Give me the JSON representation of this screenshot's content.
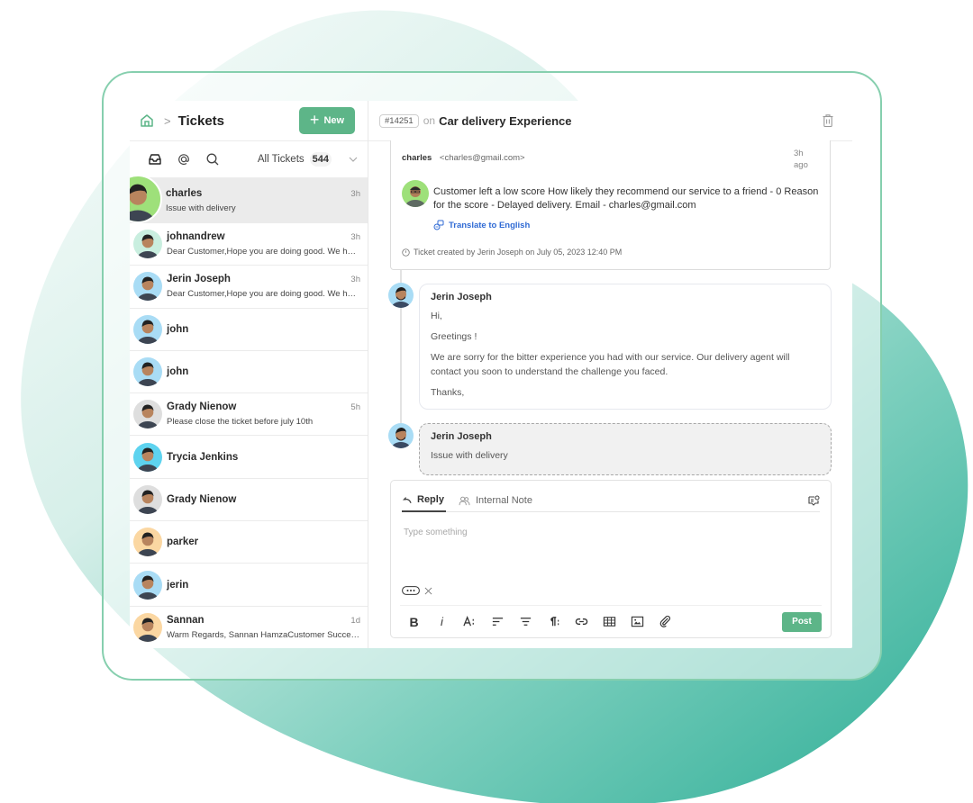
{
  "colors": {
    "brand": "#5db588",
    "link": "#2f6ad4",
    "frame_border": "#86cfae",
    "blob_dark": "#3eb39d",
    "blob_light": "#e8f5f2"
  },
  "sidebar": {
    "home_icon": "home-icon",
    "breadcrumb_separator": ">",
    "title": "Tickets",
    "new_button_icon": "plus-icon",
    "new_button_label": "New",
    "filter_icons": [
      "inbox-icon",
      "at-mention-icon",
      "search-icon"
    ],
    "filter_label": "All Tickets",
    "filter_count": "544",
    "tickets": [
      {
        "name": "charles",
        "time": "3h",
        "preview": "Issue with delivery",
        "active": true,
        "avatar_bg": "#9ee07a"
      },
      {
        "name": "johnandrew",
        "time": "3h",
        "preview": "Dear Customer,Hope you are doing good. We ha…",
        "avatar_bg": "#c9eedf"
      },
      {
        "name": "Jerin Joseph",
        "time": "3h",
        "preview": "Dear Customer,Hope you are doing good. We ha…",
        "avatar_bg": "#a9dcf5"
      },
      {
        "name": "john",
        "time": "",
        "preview": "",
        "avatar_bg": "#a9dcf5"
      },
      {
        "name": "john",
        "time": "",
        "preview": "",
        "avatar_bg": "#a9dcf5"
      },
      {
        "name": "Grady Nienow",
        "time": "5h",
        "preview": "Please close the ticket before july 10th",
        "avatar_bg": "#dedede"
      },
      {
        "name": "Trycia Jenkins",
        "time": "",
        "preview": "",
        "avatar_bg": "#5ed3ef"
      },
      {
        "name": "Grady Nienow",
        "time": "",
        "preview": "",
        "avatar_bg": "#dedede"
      },
      {
        "name": "parker",
        "time": "",
        "preview": "",
        "avatar_bg": "#fbd7a2"
      },
      {
        "name": "jerin",
        "time": "",
        "preview": "",
        "avatar_bg": "#a9dcf5"
      },
      {
        "name": "Sannan",
        "time": "1d",
        "preview": "Warm Regards, Sannan HamzaCustomer Succes…",
        "avatar_bg": "#fbd7a2"
      }
    ]
  },
  "ticket": {
    "id": "#14251",
    "on": "on",
    "title": "Car delivery Experience",
    "delete_icon": "trash-icon",
    "first_message": {
      "sender": "charles",
      "email": "<charles@gmail.com>",
      "time_line1": "3h",
      "time_line2": "ago",
      "body": "Customer left a low score How likely they recommend our service to a friend - 0 Reason for the score - Delayed delivery. Email - charles@gmail.com",
      "translate_label": "Translate to English",
      "created_info": "Ticket created by Jerin Joseph on July 05, 2023 12:40 PM"
    },
    "reply": {
      "author": "Jerin Joseph",
      "lines": [
        "Hi,",
        "Greetings !",
        "We are sorry for the bitter experience you had with our service. Our delivery agent will contact you soon to understand the challenge you faced.",
        "Thanks,"
      ]
    },
    "note": {
      "author": "Jerin Joseph",
      "text": "Issue with delivery"
    }
  },
  "composer": {
    "tabs": [
      {
        "label": "Reply",
        "icon": "reply-icon",
        "active": true
      },
      {
        "label": "Internal Note",
        "icon": "users-icon",
        "active": false
      }
    ],
    "canned_icon": "canned-response-icon",
    "placeholder": "Type something",
    "value": "",
    "toolbar": [
      "bold",
      "italic",
      "font-size",
      "align-left",
      "align-center",
      "paragraph",
      "link",
      "table",
      "image",
      "attachment"
    ],
    "toolbar_bold_label": "B",
    "toolbar_italic_label": "i",
    "post_label": "Post"
  }
}
